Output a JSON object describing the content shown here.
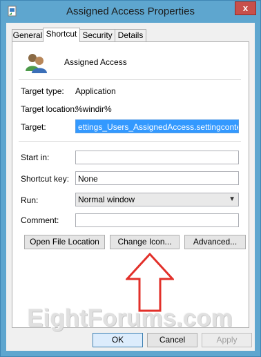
{
  "window": {
    "title": "Assigned Access Properties",
    "close_glyph": "x"
  },
  "tabs": [
    {
      "label": "General"
    },
    {
      "label": "Shortcut"
    },
    {
      "label": "Security"
    },
    {
      "label": "Details"
    }
  ],
  "app": {
    "name": "Assigned Access",
    "icon": "users-icon"
  },
  "fields": {
    "target_type_label": "Target type:",
    "target_type_value": "Application",
    "target_location_label": "Target location:",
    "target_location_value": "%windir%",
    "target_label": "Target:",
    "target_value": "ettings_Users_AssignedAccess.settingcontent-ms",
    "start_in_label": "Start in:",
    "start_in_value": "",
    "shortcut_key_label": "Shortcut key:",
    "shortcut_key_value": "None",
    "run_label": "Run:",
    "run_value": "Normal window",
    "comment_label": "Comment:",
    "comment_value": ""
  },
  "buttons": {
    "open_file_location": "Open File Location",
    "change_icon": "Change Icon...",
    "advanced": "Advanced...",
    "ok": "OK",
    "cancel": "Cancel",
    "apply": "Apply"
  },
  "watermark": "EightForums.com",
  "colors": {
    "frame": "#5ea6cf",
    "close": "#c7504b",
    "selection": "#3399ff",
    "arrow": "#e2302a"
  }
}
